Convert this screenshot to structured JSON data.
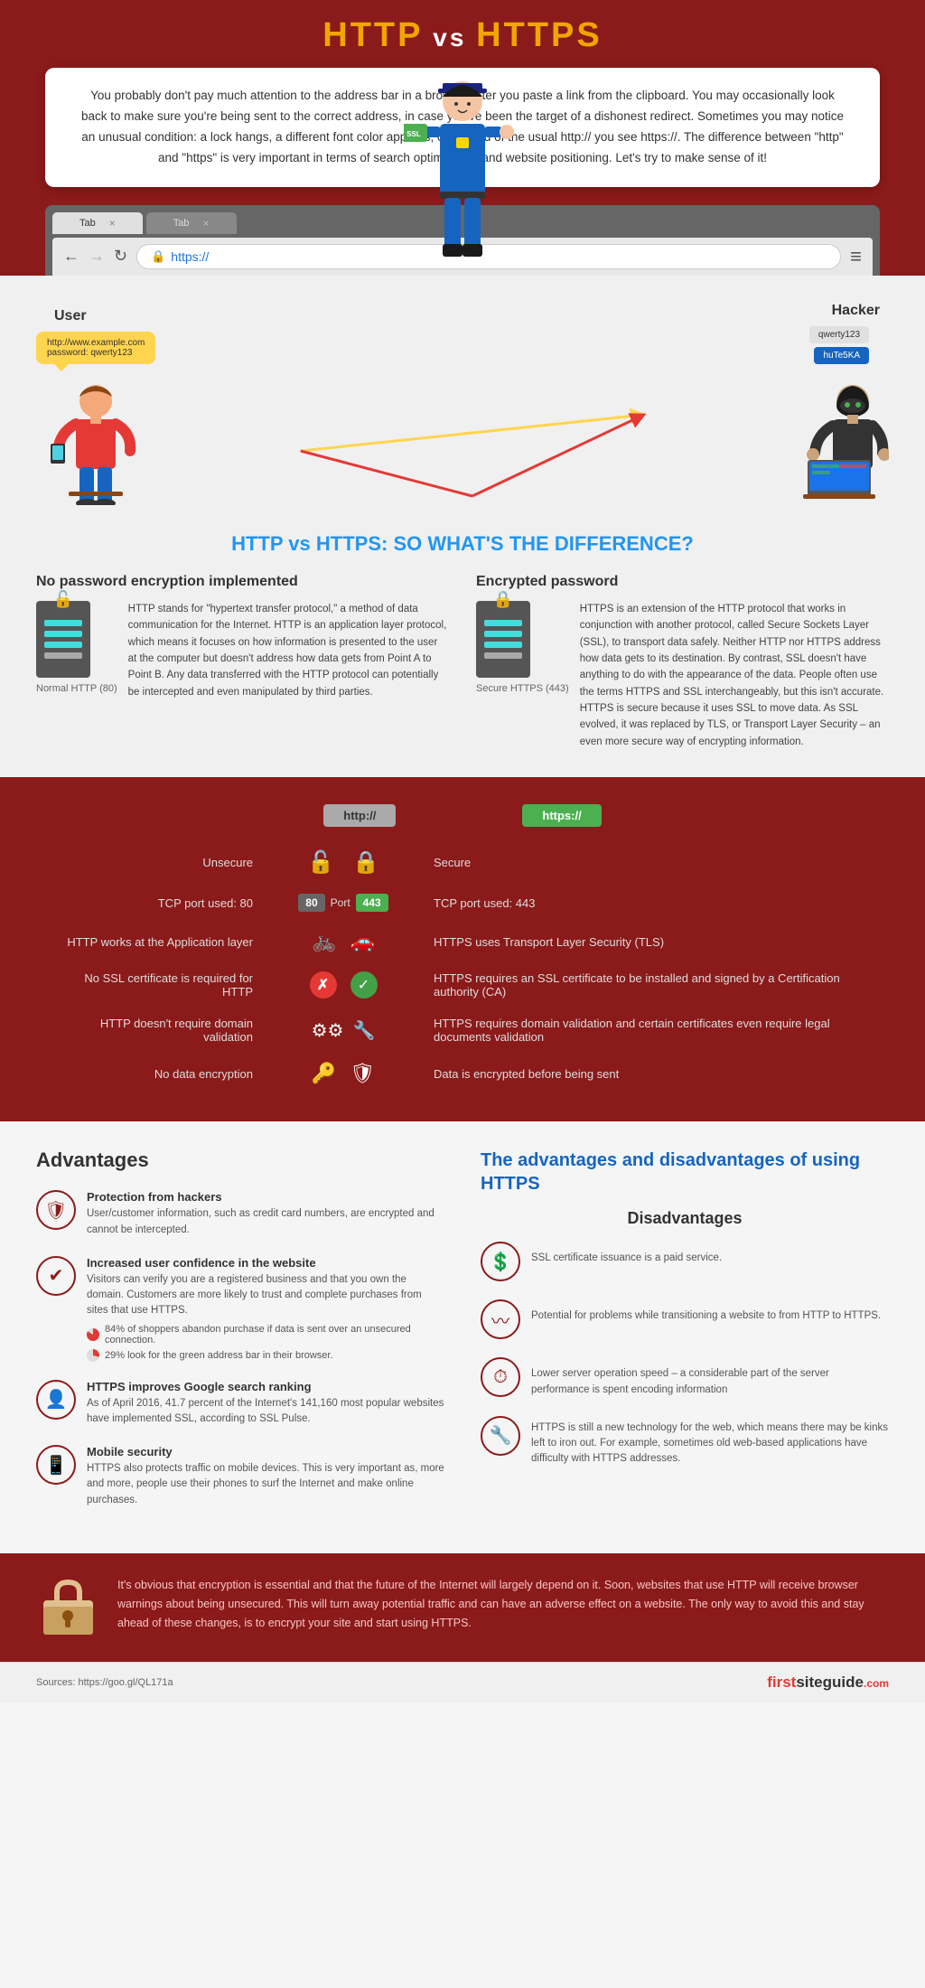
{
  "header": {
    "title_http": "HTTP",
    "title_vs": " vs ",
    "title_https": "HTTPS"
  },
  "intro": {
    "text": "You probably don't pay much attention to the address bar in a browser after you paste a link from the clipboard. You may occasionally look back to make sure you're being sent to the correct address, in case you've been the target of a dishonest redirect. Sometimes you may notice an unusual condition: a lock hangs, a different font color appears, or instead of the usual http:// you see https://. The difference between \"http\" and \"https\" is very important in terms of search optimization and website positioning. Let's try to make sense of it!"
  },
  "browser": {
    "address": "https://",
    "tab1": "×",
    "tab2": "×"
  },
  "difference": {
    "title": "HTTP vs HTTPS: SO WHAT'S THE DIFFERENCE?",
    "user_label": "User",
    "hacker_label": "Hacker",
    "user_bubble": "http://www.example.com\npassword: qwerty123",
    "hacker_bubble1": "qwerty123",
    "hacker_bubble2": "huTe5KA",
    "no_encryption_title": "No password encryption implemented",
    "http_desc": "HTTP stands for \"hypertext transfer protocol,\" a method of data communication for the Internet.\nHTTP is an application layer protocol, which means it focuses on how information is presented to the user at the computer but doesn't address how data gets from Point A to Point B. Any data transferred with the HTTP protocol can potentially be intercepted and even manipulated by third parties.",
    "http_port": "Normal HTTP (80)",
    "encrypted_title": "Encrypted password",
    "https_desc": "HTTPS is an extension of the HTTP protocol that works in conjunction with another protocol, called Secure Sockets Layer (SSL), to transport data safely.\nNeither HTTP nor HTTPS address how data gets to its destination. By contrast, SSL doesn't have anything to do with the appearance of the data.\nPeople often use the terms HTTPS and SSL interchangeably, but this isn't accurate. HTTPS is secure because it uses SSL to move data. As SSL evolved, it was replaced by TLS, or Transport Layer Security – an even more secure way of encrypting information.",
    "https_port": "Secure HTTPS (443)"
  },
  "comparison": {
    "http_label": "http://",
    "https_label": "https://",
    "rows": [
      {
        "left": "Unsecure",
        "right": "Secure",
        "left_icon": "🔓",
        "right_icon": "🔒"
      },
      {
        "left": "TCP port used: 80",
        "center": "80 Port 443",
        "right": "TCP port used: 443"
      },
      {
        "left": "HTTP works at the Application layer",
        "left_icon": "🚲",
        "right_icon": "🚗",
        "right": "HTTPS uses Transport Layer Security (TLS)"
      },
      {
        "left": "No SSL certificate is required for HTTP",
        "left_icon": "✗",
        "right_icon": "✓",
        "right": "HTTPS requires an SSL certificate to be installed and signed by a Certification authority (CA)"
      },
      {
        "left": "HTTP doesn't require domain validation",
        "left_icon": "⚙⚙",
        "right_icon": "🔧",
        "right": "HTTPS requires domain validation and certain certificates even require legal documents validation"
      },
      {
        "left": "No data encryption",
        "left_icon": "🔑",
        "right_icon": "⚔",
        "right": "Data is encrypted before being sent"
      }
    ]
  },
  "advantages": {
    "title": "Advantages",
    "items": [
      {
        "icon": "🛡",
        "title": "Protection from hackers",
        "desc": "User/customer information, such as credit card numbers, are encrypted and cannot be intercepted."
      },
      {
        "icon": "✓",
        "title": "Increased user confidence in the website",
        "desc": "Visitors can verify you are a registered business and that you own the domain. Customers are more likely to trust and complete purchases from sites that use HTTPS.",
        "stats": [
          "84% of shoppers abandon purchase if data is sent over an unsecured connection.",
          "29% look for the green address bar in their browser."
        ]
      },
      {
        "icon": "👤",
        "title": "HTTPS improves Google search ranking",
        "desc": "As of April 2016, 41.7 percent of the Internet's 141,160 most popular websites have implemented SSL, according to SSL Pulse."
      },
      {
        "icon": "📱",
        "title": "Mobile security",
        "desc": "HTTPS also protects traffic on mobile devices. This is very important as, more and more, people use their phones to surf the Internet and make online purchases."
      }
    ]
  },
  "adv_dis_title": "The advantages and disadvantages of using HTTPS",
  "disadvantages": {
    "title": "Disadvantages",
    "items": [
      {
        "icon": "💲",
        "desc": "SSL certificate issuance is a paid service."
      },
      {
        "icon": "〰",
        "desc": "Potential for problems while transitioning a website to from HTTP to HTTPS."
      },
      {
        "icon": "⏱",
        "desc": "Lower server operation speed – a considerable part of the server performance is spent encoding information"
      },
      {
        "icon": "🔧",
        "desc": "HTTPS is still a new technology for the web, which means there may be kinks left to iron out. For example, sometimes old web-based applications have difficulty with HTTPS addresses."
      }
    ]
  },
  "footer": {
    "text": "It's obvious that encryption is essential and that the future of the Internet will largely depend on it. Soon, websites that use HTTP will receive browser warnings about being unsecured. This will turn away potential traffic and can have an adverse effect on a website. The only way to avoid this and stay ahead of these changes, is to encrypt your site and start using HTTPS.",
    "source": "Sources: https://goo.gl/QL171a",
    "brand_first": "first",
    "brand_site": "site",
    "brand_guide": "guide",
    "brand_com": ".com"
  }
}
